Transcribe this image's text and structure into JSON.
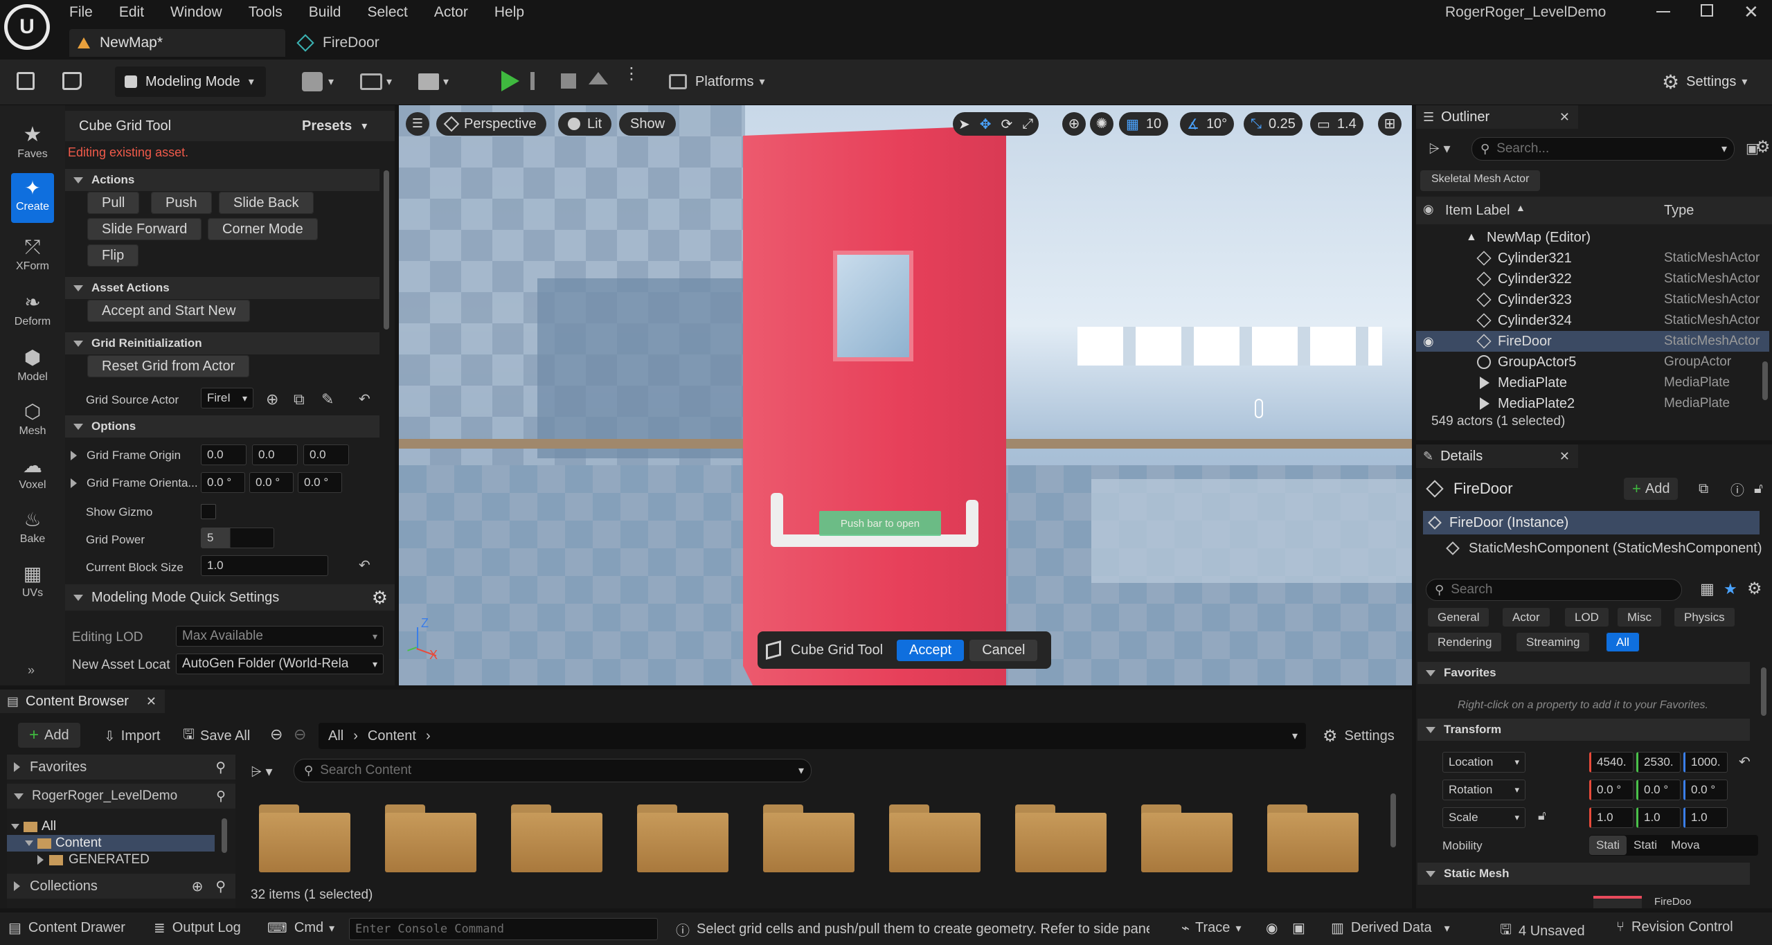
{
  "window": {
    "title": "RogerRoger_LevelDemo",
    "menu": [
      "File",
      "Edit",
      "Window",
      "Tools",
      "Build",
      "Select",
      "Actor",
      "Help"
    ],
    "tabs": [
      {
        "label": "NewMap*",
        "active": true
      },
      {
        "label": "FireDoor",
        "active": false
      }
    ]
  },
  "toolbar": {
    "mode_label": "Modeling Mode",
    "platforms_label": "Platforms",
    "settings_label": "Settings"
  },
  "left_toolbar": {
    "items": [
      "Faves",
      "Create",
      "XForm",
      "Deform",
      "Model",
      "Mesh",
      "Voxel",
      "Bake",
      "UVs"
    ],
    "active": "Create"
  },
  "tool_panel": {
    "title": "Cube Grid Tool",
    "presets_label": "Presets",
    "warning": "Editing existing asset.",
    "sections": {
      "actions": "Actions",
      "asset_actions": "Asset Actions",
      "grid_reinit": "Grid Reinitialization",
      "options": "Options",
      "quick_settings": "Modeling Mode Quick Settings"
    },
    "action_buttons": [
      "Pull",
      "Push",
      "Slide Back",
      "Slide Forward",
      "Corner Mode",
      "Flip"
    ],
    "accept_start_new": "Accept and Start New",
    "reset_grid": "Reset Grid from Actor",
    "grid_source_label": "Grid Source Actor",
    "grid_source_value": "FireI",
    "grid_frame_origin_label": "Grid Frame Origin",
    "grid_frame_origin": [
      "0.0",
      "0.0",
      "0.0"
    ],
    "grid_frame_orient_label": "Grid Frame Orienta...",
    "grid_frame_orient": [
      "0.0 °",
      "0.0 °",
      "0.0 °"
    ],
    "show_gizmo_label": "Show Gizmo",
    "grid_power_label": "Grid Power",
    "grid_power_value": "5",
    "block_size_label": "Current Block Size",
    "block_size_value": "1.0",
    "editing_lod_label": "Editing LOD",
    "editing_lod_value": "Max Available",
    "new_asset_label": "New Asset Locat",
    "new_asset_value": "AutoGen Folder (World-Rela"
  },
  "viewport": {
    "perspective_label": "Perspective",
    "lit_label": "Lit",
    "show_label": "Show",
    "grid_snap": "10",
    "angle_snap": "10°",
    "scale_snap": "0.25",
    "camera_speed": "1.4",
    "door_sign": "Push bar to open",
    "axis_z": "Z",
    "axis_x": "X",
    "tool_bar": {
      "name": "Cube Grid Tool",
      "accept": "Accept",
      "cancel": "Cancel"
    }
  },
  "outliner": {
    "title": "Outliner",
    "search_placeholder": "Search...",
    "filter_chip": "Skeletal Mesh Actor",
    "col_label": "Item Label",
    "col_type": "Type",
    "root": "NewMap (Editor)",
    "rows": [
      {
        "label": "Cylinder321",
        "type": "StaticMeshActor",
        "selected": false
      },
      {
        "label": "Cylinder322",
        "type": "StaticMeshActor",
        "selected": false
      },
      {
        "label": "Cylinder323",
        "type": "StaticMeshActor",
        "selected": false
      },
      {
        "label": "Cylinder324",
        "type": "StaticMeshActor",
        "selected": false
      },
      {
        "label": "FireDoor",
        "type": "StaticMeshActor",
        "selected": true
      },
      {
        "label": "GroupActor5",
        "type": "GroupActor",
        "selected": false
      },
      {
        "label": "MediaPlate",
        "type": "MediaPlate",
        "selected": false
      },
      {
        "label": "MediaPlate2",
        "type": "MediaPlate",
        "selected": false
      }
    ],
    "count": "549 actors (1 selected)"
  },
  "details": {
    "title": "Details",
    "actor_name": "FireDoor",
    "add_label": "Add",
    "instance_label": "FireDoor (Instance)",
    "component_label": "StaticMeshComponent (StaticMeshComponent)",
    "search_placeholder": "Search",
    "filter_tabs": [
      "General",
      "Actor",
      "LOD",
      "Misc",
      "Physics",
      "Rendering",
      "Streaming",
      "All"
    ],
    "active_filter": "All",
    "favorites_label": "Favorites",
    "favorites_hint": "Right-click on a property to add it to your Favorites.",
    "transform_label": "Transform",
    "location_label": "Location",
    "location": [
      "4540.",
      "2530.",
      "1000."
    ],
    "rotation_label": "Rotation",
    "rotation": [
      "0.0 °",
      "0.0 °",
      "0.0 °"
    ],
    "scale_label": "Scale",
    "scale": [
      "1.0",
      "1.0",
      "1.0"
    ],
    "mobility_label": "Mobility",
    "mobility_options": [
      "Stati",
      "Stati",
      "Mova"
    ],
    "static_mesh_label": "Static Mesh",
    "static_mesh_value": "FireDoo"
  },
  "content_browser": {
    "title": "Content Browser",
    "add_label": "Add",
    "import_label": "Import",
    "save_all_label": "Save All",
    "path": [
      "All",
      "Content"
    ],
    "settings_label": "Settings",
    "search_placeholder": "Search Content",
    "favorites_label": "Favorites",
    "project_label": "RogerRoger_LevelDemo",
    "tree": [
      "All",
      "Content",
      "GENERATED"
    ],
    "collections_label": "Collections",
    "status": "32 items (1 selected)",
    "folder_count": 9
  },
  "status_bar": {
    "content_drawer": "Content Drawer",
    "output_log": "Output Log",
    "cmd": "Cmd",
    "console_placeholder": "Enter Console Command",
    "message": "Select grid cells and push/pull them to create geometry. Refer to side panel",
    "trace": "Trace",
    "derived_data": "Derived Data",
    "unsaved": "4 Unsaved",
    "revision_control": "Revision Control"
  },
  "colors": {
    "accent_blue": "#0f6fde",
    "selection": "#3b4a63",
    "door_red": "#e8485c",
    "warning": "#f05a4a",
    "play_green": "#3fb93f"
  }
}
